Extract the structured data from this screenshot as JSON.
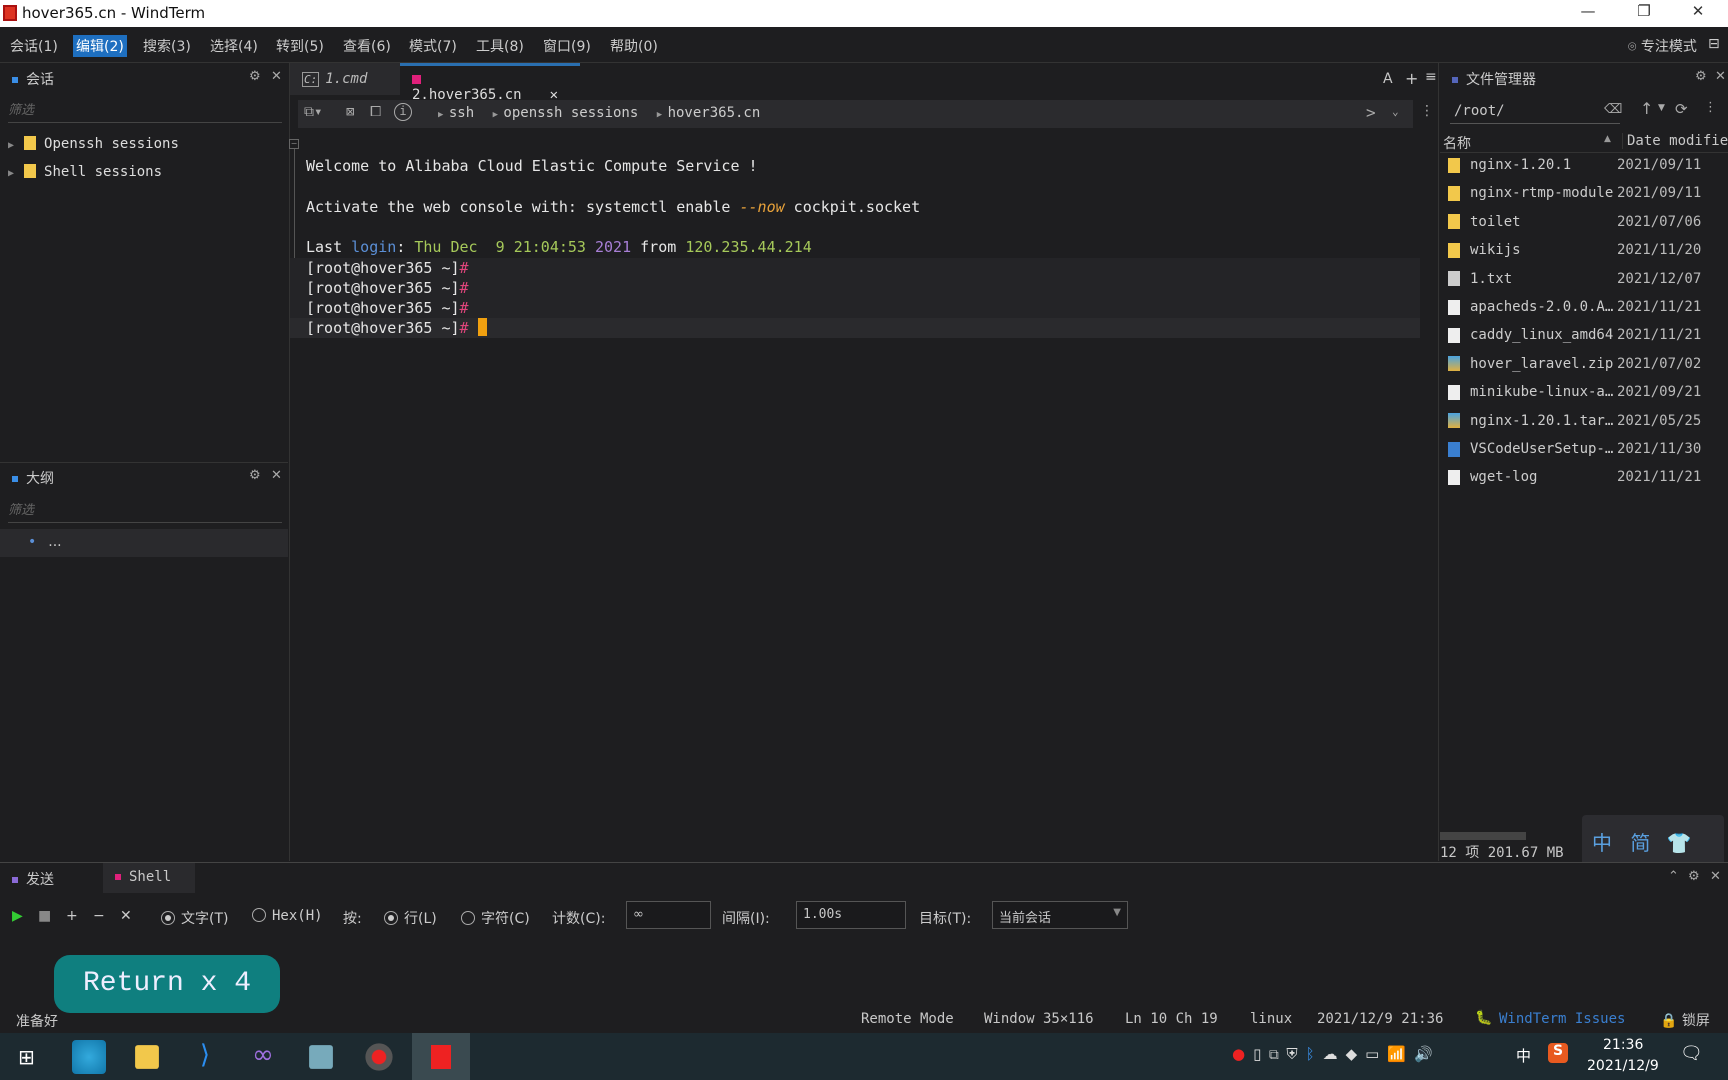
{
  "window": {
    "title": "hover365.cn - WindTerm",
    "minimize": "—",
    "restore": "❐",
    "close": "✕"
  },
  "menu": [
    "会话(1)",
    "编辑(2)",
    "搜索(3)",
    "选择(4)",
    "转到(5)",
    "查看(6)",
    "模式(7)",
    "工具(8)",
    "窗口(9)",
    "帮助(0)"
  ],
  "focus_mode": "专注模式",
  "sessions_panel": {
    "title": "会话",
    "filter_placeholder": "筛选",
    "items": [
      "Openssh sessions",
      "Shell sessions"
    ]
  },
  "outline_panel": {
    "title": "大纲",
    "filter_placeholder": "筛选",
    "item": "..."
  },
  "tabs": [
    {
      "label": "1.cmd"
    },
    {
      "label": "2.hover365.cn"
    }
  ],
  "tab_actions": {
    "font": "A",
    "add": "+",
    "menu": "≡"
  },
  "breadcrumb": [
    "ssh",
    "openssh sessions",
    "hover365.cn"
  ],
  "terminal": {
    "welcome": "Welcome to Alibaba Cloud Elastic Compute Service !",
    "activate_prefix": "Activate the web console with: systemctl enable ",
    "activate_flag": "--now",
    "activate_suffix": " cockpit.socket",
    "last": "Last ",
    "login": "login",
    ":": ":",
    "date": " Thu Dec  9 21:04:53 ",
    "year": "2021",
    "from": " from ",
    "ip": "120.235.44.214",
    "prompt": "[root@hover365 ~]",
    "hash": "#"
  },
  "file_manager": {
    "title": "文件管理器",
    "path": "/root/",
    "col_name": "名称",
    "col_date": "Date modifie",
    "files": [
      {
        "name": "nginx-1.20.1",
        "date": "2021/09/11",
        "type": "folder"
      },
      {
        "name": "nginx-rtmp-module",
        "date": "2021/09/11",
        "type": "folder"
      },
      {
        "name": "toilet",
        "date": "2021/07/06",
        "type": "folder"
      },
      {
        "name": "wikijs",
        "date": "2021/11/20",
        "type": "folder"
      },
      {
        "name": "1.txt",
        "date": "2021/12/07",
        "type": "text"
      },
      {
        "name": "apacheds-2.0.0.A…",
        "date": "2021/11/21",
        "type": "file"
      },
      {
        "name": "caddy_linux_amd64",
        "date": "2021/11/21",
        "type": "file"
      },
      {
        "name": "hover_laravel.zip",
        "date": "2021/07/02",
        "type": "archive"
      },
      {
        "name": "minikube-linux-a…",
        "date": "2021/09/21",
        "type": "file"
      },
      {
        "name": "nginx-1.20.1.tar…",
        "date": "2021/05/25",
        "type": "archive"
      },
      {
        "name": "VSCodeUserSetup-…",
        "date": "2021/11/30",
        "type": "installer"
      },
      {
        "name": "wget-log",
        "date": "2021/11/21",
        "type": "file"
      }
    ],
    "summary": "12 项 201.67 MB"
  },
  "ime": {
    "lang": "中",
    "mode": "简"
  },
  "send_panel": {
    "tabs": [
      "发送",
      "Shell"
    ],
    "text_label": "文字(T)",
    "hex_label": "Hex(H)",
    "by_label": "按:",
    "line_label": "行(L)",
    "char_label": "字符(C)",
    "count_label": "计数(C):",
    "count_value": "∞",
    "interval_label": "间隔(I):",
    "interval_value": "1.00s",
    "target_label": "目标(T):",
    "target_value": "当前会话"
  },
  "overlay": "Return x 4",
  "status": {
    "ready": "准备好",
    "mode": "Remote Mode",
    "window": "Window 35×116",
    "pos": "Ln 10 Ch 19",
    "os": "linux",
    "datetime": "2021/12/9 21:36",
    "issues": "WindTerm Issues",
    "lock": "锁屏"
  },
  "taskbar": {
    "time": "21:36",
    "date": "2021/12/9",
    "ime": "中"
  },
  "colors": {
    "accent": "#1e6fc0",
    "login": "#5b8fd6",
    "date": "#a6c95a",
    "year": "#a87fd6",
    "flag": "#e8a23a",
    "hash": "#e0457b",
    "cursor": "#f0a010",
    "overlay": "#0f7f7f"
  }
}
